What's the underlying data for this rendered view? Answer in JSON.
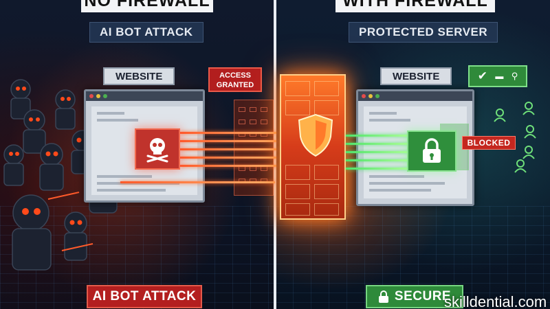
{
  "left_panel": {
    "banner": "NO FIREWALL",
    "header_label": "AI BOT ATTACK",
    "website_label": "WEBSITE",
    "access_badge_line1": "ACCESS",
    "access_badge_line2": "GRANTED",
    "skull_icon": "skull-crossbones-icon",
    "bottom_label": "AI BOT ATTACK"
  },
  "right_panel": {
    "banner": "WITH FIREWALL",
    "header_label": "PROTECTED SERVER",
    "website_label": "WEBSITE",
    "status_icons": [
      "check-icon",
      "camera-icon",
      "search-icon"
    ],
    "blocked_badge": "BLOCKED",
    "lock_icon": "padlock-icon",
    "bottom_label": "SECURE",
    "bottom_icon": "padlock-icon"
  },
  "firewall": {
    "icon": "shield-icon"
  },
  "watermark": "skilldential.com",
  "colors": {
    "attack_red": "#c0332c",
    "secure_green": "#2f8f3c",
    "firewall_orange": "#ff7a2a"
  }
}
